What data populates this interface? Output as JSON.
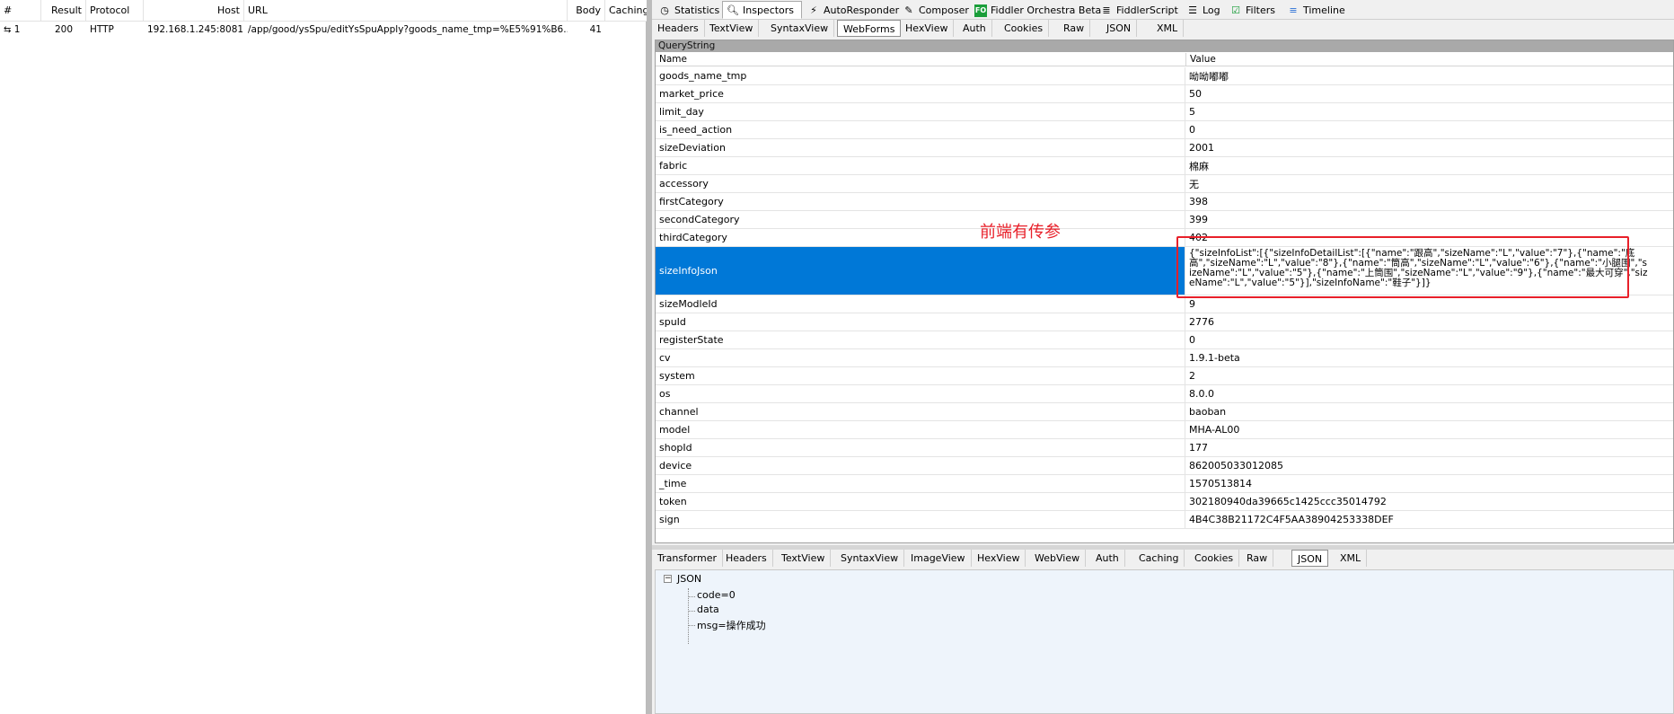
{
  "sessions": {
    "columns": [
      "#",
      "Result",
      "Protocol",
      "Host",
      "URL",
      "Body",
      "Caching"
    ],
    "rows": [
      {
        "num": "1",
        "result": "200",
        "protocol": "HTTP",
        "host": "192.168.1.245:8081",
        "url": "/app/good/ysSpu/editYsSpuApply?goods_name_tmp=%E5%91%B6...",
        "body": "41",
        "caching": ""
      }
    ]
  },
  "main_tabs": [
    {
      "label": "Statistics",
      "icon": "stopwatch-icon"
    },
    {
      "label": "Inspectors",
      "icon": "magnifier-icon"
    },
    {
      "label": "AutoResponder",
      "icon": "lightning-icon"
    },
    {
      "label": "Composer",
      "icon": "pencil-icon"
    },
    {
      "label": "Fiddler Orchestra Beta",
      "icon": "fo-icon"
    },
    {
      "label": "FiddlerScript",
      "icon": "script-icon"
    },
    {
      "label": "Log",
      "icon": "log-icon"
    },
    {
      "label": "Filters",
      "icon": "checkbox-icon"
    },
    {
      "label": "Timeline",
      "icon": "timeline-icon"
    }
  ],
  "request_tabs": [
    "Headers",
    "TextView",
    "SyntaxView",
    "WebForms",
    "HexView",
    "Auth",
    "Cookies",
    "Raw",
    "JSON",
    "XML"
  ],
  "querystring": {
    "title": "QueryString",
    "col_name": "Name",
    "col_value": "Value",
    "rows": [
      {
        "name": "goods_name_tmp",
        "value": "呦呦嘟嘟"
      },
      {
        "name": "market_price",
        "value": "50"
      },
      {
        "name": "limit_day",
        "value": "5"
      },
      {
        "name": "is_need_action",
        "value": "0"
      },
      {
        "name": "sizeDeviation",
        "value": "2001"
      },
      {
        "name": "fabric",
        "value": "棉麻"
      },
      {
        "name": "accessory",
        "value": "无"
      },
      {
        "name": "firstCategory",
        "value": "398"
      },
      {
        "name": "secondCategory",
        "value": "399"
      },
      {
        "name": "thirdCategory",
        "value": "402"
      },
      {
        "name": "sizeInfoJson",
        "value": "{\"sizeInfoList\":[{\"sizeInfoDetailList\":[{\"name\":\"跟高\",\"sizeName\":\"L\",\"value\":\"7\"},{\"name\":\"底高\",\"sizeName\":\"L\",\"value\":\"8\"},{\"name\":\"筒高\",\"sizeName\":\"L\",\"value\":\"6\"},{\"name\":\"小腿围\",\"sizeName\":\"L\",\"value\":\"5\"},{\"name\":\"上筒围\",\"sizeName\":\"L\",\"value\":\"9\"},{\"name\":\"最大可穿\",\"sizeName\":\"L\",\"value\":\"5\"}],\"sizeInfoName\":\"鞋子\"}]}"
      },
      {
        "name": "sizeModleId",
        "value": "9"
      },
      {
        "name": "spuId",
        "value": "2776"
      },
      {
        "name": "registerState",
        "value": "0"
      },
      {
        "name": "cv",
        "value": "1.9.1-beta"
      },
      {
        "name": "system",
        "value": "2"
      },
      {
        "name": "os",
        "value": "8.0.0"
      },
      {
        "name": "channel",
        "value": "baoban"
      },
      {
        "name": "model",
        "value": "MHA-AL00"
      },
      {
        "name": "shopId",
        "value": "177"
      },
      {
        "name": "device",
        "value": "862005033012085"
      },
      {
        "name": "_time",
        "value": "1570513814"
      },
      {
        "name": "token",
        "value": "302180940da39665c1425ccc35014792"
      },
      {
        "name": "sign",
        "value": "4B4C38B21172C4F5AA38904253338DEF"
      }
    ]
  },
  "annotation": "前端有传参",
  "response_tabs": [
    "Transformer",
    "Headers",
    "TextView",
    "SyntaxView",
    "ImageView",
    "HexView",
    "WebView",
    "Auth",
    "Caching",
    "Cookies",
    "Raw",
    "JSON",
    "XML"
  ],
  "json_tree": {
    "root": "JSON",
    "children": [
      "code=0",
      "data",
      "msg=操作成功"
    ]
  },
  "colors": {
    "selection": "#0078d7",
    "annotation": "#e8202a"
  }
}
